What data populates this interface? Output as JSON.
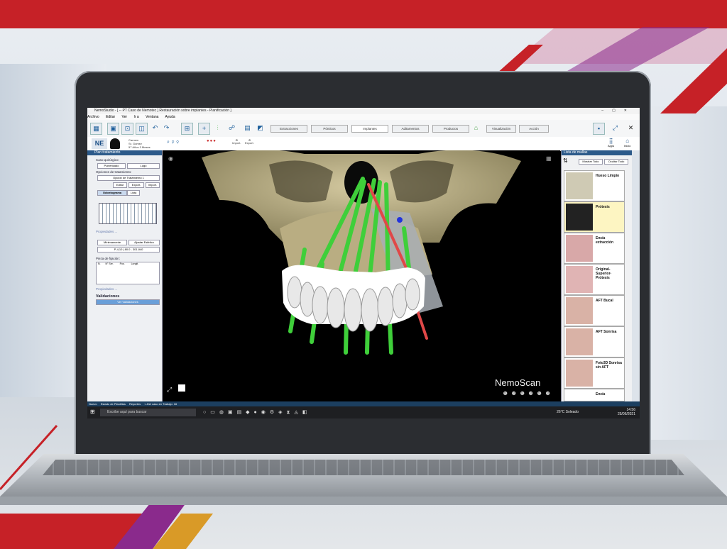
{
  "window": {
    "title": "NemoStudio - [ -- PT Caso de Nemotec ] Restauración sobre implantes - Planificación ]",
    "menu": [
      "Archivo",
      "Editar",
      "Ver",
      "Ir a",
      "Ventana",
      "Ayuda"
    ]
  },
  "toolbar": {
    "tabs": [
      "Extracciones",
      "Pónticos",
      "Implantes",
      "Aditamentos",
      "Productos",
      "Visualización",
      "Acción"
    ],
    "right_labels": {
      "apps": "Apps",
      "home": "Inicio"
    }
  },
  "patient": {
    "initials": "NE",
    "lines": [
      "Carmen",
      "Sr. Gómez",
      "57 Años 3 Meses"
    ],
    "import_labels": [
      "Import.",
      "Export."
    ]
  },
  "left_panel": {
    "title": "Plan tratamiento",
    "cases_label": "Caso quirúrgico:",
    "case_select": "Pulverizado",
    "case_select2": "Lugo",
    "options_label": "Opciones de tratamiento:",
    "option_select": "Opción de Tratamiento 1",
    "buttons": [
      "Editar",
      "Export.",
      "Import."
    ],
    "tabs": [
      "Odontograma",
      "Lista"
    ],
    "properties_label": "Propiedades ...",
    "dropdowns": [
      "Mínimamente",
      "Ajustar Estético"
    ],
    "readout": "P-4,10 | 80.0 - 301,940",
    "fixation_label": "Pieza de fijación:",
    "fixation_cols": [
      "N.",
      "N° Ser.",
      "Pos.",
      "Longit."
    ],
    "properties2_label": "Propiedades ...",
    "validations": "Validaciones",
    "validate_button": "Ver Validaciones"
  },
  "right_panel": {
    "title": "Lista de mallas",
    "show_all": "Mostrar Todo",
    "hide_all": "Ocultar Todo",
    "items": [
      {
        "label": "Hueso Limpio"
      },
      {
        "label": "Prótesis"
      },
      {
        "label": "Encía extracción"
      },
      {
        "label": "Original-Superior-Prótesis"
      },
      {
        "label": "AFT Bucal"
      },
      {
        "label": "AFT Sonrisa"
      },
      {
        "label": "Foto3D Sonrisa sin AFT"
      },
      {
        "label": "Encía"
      }
    ]
  },
  "viewport": {
    "brand": "NemoScan"
  },
  "statusbar": {
    "items": [
      "Nuevo",
      "Estado de Plantillas",
      "Reportes",
      "<-Del caso en Trabajo: 16"
    ]
  },
  "taskbar": {
    "search_placeholder": "Escribe aquí para buscar",
    "weather": "26°C  Soleado",
    "time": "14:56",
    "date": "25/06/2021"
  },
  "colors": {
    "brand_red": "#c62127",
    "accent_purple": "#8a2a8c",
    "panel_blue": "#2c5a8a",
    "implant_green": "#3fcf3a"
  }
}
